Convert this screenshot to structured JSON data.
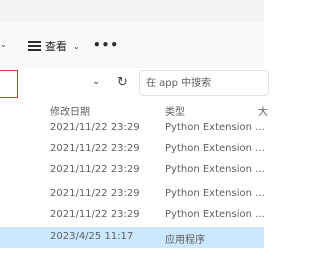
{
  "toolbar": {
    "view_label": "查看",
    "more_label": "•••"
  },
  "search": {
    "placeholder": "在 app 中搜索"
  },
  "columns": {
    "date_modified": "修改日期",
    "type": "类型",
    "size": "大"
  },
  "files": [
    {
      "date": "2021/11/22 23:29",
      "type": "Python Extension ..."
    },
    {
      "date": "2021/11/22 23:29",
      "type": "Python Extension ..."
    },
    {
      "date": "2021/11/22 23:29",
      "type": "Python Extension ..."
    },
    {
      "date": "2021/11/22 23:29",
      "type": "Python Extension ..."
    },
    {
      "date": "2021/11/22 23:29",
      "type": "Python Extension ..."
    },
    {
      "date": "2023/4/25 11:17",
      "type": "应用程序",
      "selected": true
    }
  ]
}
